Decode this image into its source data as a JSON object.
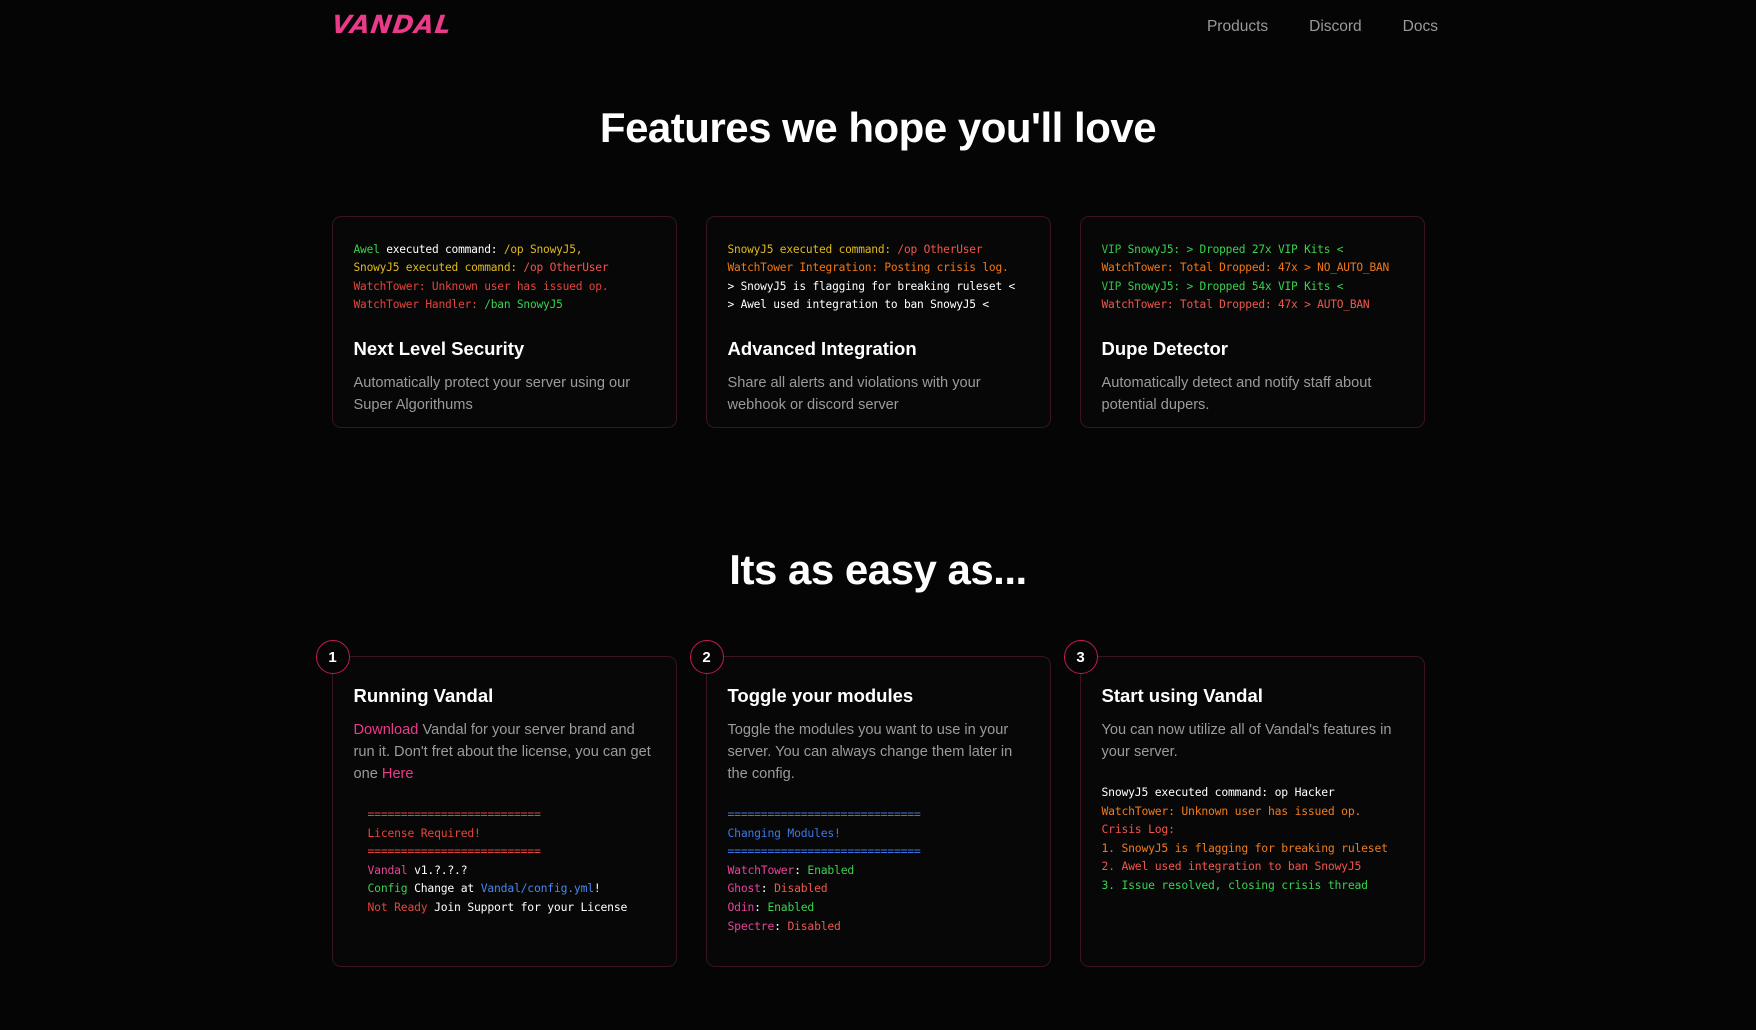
{
  "brand": {
    "logo": "VANDAL",
    "accent": "#EC3A8B"
  },
  "nav": {
    "links": [
      {
        "label": "Products"
      },
      {
        "label": "Discord"
      },
      {
        "label": "Docs"
      }
    ]
  },
  "features": {
    "heading": "Features we hope you'll love",
    "cards": [
      {
        "terminal": [
          [
            {
              "t": "Awel",
              "c": "c-green"
            },
            {
              "t": " executed command: ",
              "c": "c-white"
            },
            {
              "t": "/op SnowyJ5,",
              "c": "c-gold"
            }
          ],
          [
            {
              "t": "SnowyJ5 executed command: ",
              "c": "c-gold"
            },
            {
              "t": "/op OtherUser",
              "c": "c-salmon"
            }
          ],
          [
            {
              "t": "WatchTower: Unknown user has issued op.",
              "c": "c-red"
            }
          ],
          [
            {
              "t": "WatchTower Handler: ",
              "c": "c-red"
            },
            {
              "t": "/ban SnowyJ5",
              "c": "c-green"
            }
          ]
        ],
        "title": "Next Level Security",
        "desc": "Automatically protect your server using our Super Algorithums"
      },
      {
        "terminal": [
          [
            {
              "t": "SnowyJ5 executed command: ",
              "c": "c-gold"
            },
            {
              "t": "/op OtherUser",
              "c": "c-salmon"
            }
          ],
          [
            {
              "t": "WatchTower Integration: Posting crisis log.",
              "c": "c-orange"
            }
          ],
          [
            {
              "t": "> SnowyJ5 is flagging for breaking ruleset <",
              "c": "c-white"
            }
          ],
          [
            {
              "t": "> Awel used integration to ban SnowyJ5 <",
              "c": "c-white"
            }
          ]
        ],
        "title": "Advanced Integration",
        "desc": "Share all alerts and violations with your webhook or discord server"
      },
      {
        "terminal": [
          [
            {
              "t": "VIP",
              "c": "c-green2"
            },
            {
              "t": " SnowyJ5: > Dropped 27x VIP Kits <",
              "c": "c-green"
            }
          ],
          [
            {
              "t": "WatchTower: Total Dropped: 47x > NO_AUTO_BAN",
              "c": "c-orange"
            }
          ],
          [
            {
              "t": "VIP",
              "c": "c-green2"
            },
            {
              "t": " SnowyJ5: > Dropped 54x VIP Kits <",
              "c": "c-green"
            }
          ],
          [
            {
              "t": "WatchTower: Total Dropped: 47x > AUTO_BAN",
              "c": "c-salmon"
            }
          ]
        ],
        "title": "Dupe Detector",
        "desc": "Automatically detect and notify staff about potential dupers."
      }
    ]
  },
  "steps": {
    "heading": "Its as easy as...",
    "items": [
      {
        "number": "1",
        "title": "Running Vandal",
        "desc_parts": [
          {
            "t": "Download",
            "link": true
          },
          {
            "t": " Vandal for your server brand and run it. Don't fret about the license, you can get one ",
            "link": false
          },
          {
            "t": "Here",
            "link": true
          }
        ],
        "terminal": [
          [
            {
              "t": "==========================",
              "c": "c-red"
            }
          ],
          [
            {
              "t": "License Required!",
              "c": "c-red"
            }
          ],
          [
            {
              "t": "==========================",
              "c": "c-red"
            }
          ],
          [
            {
              "t": "Vandal",
              "c": "c-pink"
            },
            {
              "t": " v1.?.?.?",
              "c": "c-white"
            }
          ],
          [
            {
              "t": "Config",
              "c": "c-green"
            },
            {
              "t": " Change at ",
              "c": "c-white"
            },
            {
              "t": "Vandal/config.yml",
              "c": "c-blue2"
            },
            {
              "t": "!",
              "c": "c-white"
            }
          ],
          [
            {
              "t": "Not Ready",
              "c": "c-red"
            },
            {
              "t": " Join Support for your License",
              "c": "c-white"
            }
          ]
        ]
      },
      {
        "number": "2",
        "title": "Toggle your modules",
        "desc_parts": [
          {
            "t": "Toggle the modules you want to use in your server. You can always change them later in the config.",
            "link": false
          }
        ],
        "terminal": [
          [
            {
              "t": "=============================",
              "c": "c-blue"
            }
          ],
          [
            {
              "t": "Changing Modules!",
              "c": "c-blue"
            }
          ],
          [
            {
              "t": "=============================",
              "c": "c-blue"
            }
          ],
          [
            {
              "t": "WatchTower",
              "c": "c-pink"
            },
            {
              "t": ": ",
              "c": "c-white"
            },
            {
              "t": "Enabled",
              "c": "c-green"
            }
          ],
          [
            {
              "t": "Ghost",
              "c": "c-pink"
            },
            {
              "t": ": ",
              "c": "c-white"
            },
            {
              "t": "Disabled",
              "c": "c-salmon"
            }
          ],
          [
            {
              "t": "Odin",
              "c": "c-pink"
            },
            {
              "t": ": ",
              "c": "c-white"
            },
            {
              "t": "Enabled",
              "c": "c-green"
            }
          ],
          [
            {
              "t": "Spectre",
              "c": "c-pink"
            },
            {
              "t": ": ",
              "c": "c-white"
            },
            {
              "t": "Disabled",
              "c": "c-salmon"
            }
          ]
        ]
      },
      {
        "number": "3",
        "title": "Start using Vandal",
        "desc_parts": [
          {
            "t": "You can now utilize all of Vandal's features in your server.",
            "link": false
          }
        ],
        "terminal": [
          [
            {
              "t": "SnowyJ5 executed command: op Hacker",
              "c": "c-white"
            }
          ],
          [
            {
              "t": "WatchTower: Unknown user has issued op.",
              "c": "c-orange2"
            }
          ],
          [
            {
              "t": "Crisis Log:",
              "c": "c-salmon"
            }
          ],
          [
            {
              "t": "1. SnowyJ5 is flagging for breaking ruleset",
              "c": "c-orange2"
            }
          ],
          [
            {
              "t": "2. Awel used integration to ban SnowyJ5",
              "c": "c-salmon"
            }
          ],
          [
            {
              "t": "3. Issue resolved, closing crisis thread",
              "c": "c-green"
            }
          ]
        ]
      }
    ]
  }
}
